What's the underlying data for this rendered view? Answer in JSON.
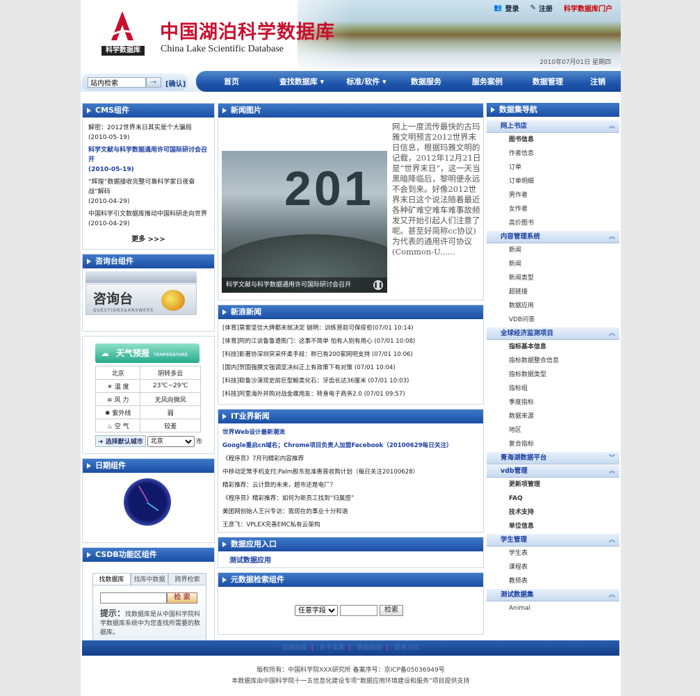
{
  "header": {
    "title_cn": "中国湖泊科学数据库",
    "title_en": "China Lake Scientific Database",
    "logo_label": "科学数据库",
    "login": "登录",
    "register": "注册",
    "portal": "科学数据库门户",
    "date": "2010年07月01日  星期四"
  },
  "search": {
    "placeholder": "站内检索",
    "confirm": "[确认]"
  },
  "nav": [
    "首页",
    "查找数据库 ▾",
    "标准/软件 ▾",
    "数据服务",
    "服务案例",
    "数据管理",
    "注销"
  ],
  "cms": {
    "title": "CMS组件",
    "items": [
      {
        "text": "解密：2012世界末日其实是个大骗局",
        "date": "(2010-05-19)",
        "hot": false
      },
      {
        "text": "科学文献与科学数据通用许可国际研讨会召开",
        "date": "(2010-05-19)",
        "hot": true
      },
      {
        "text": "“辉煌”数据接收完整可靠科学家日夜奋战”解码",
        "date": "(2010-04-29)",
        "hot": false
      },
      {
        "text": "中国科学引文数据库推动中国科研走向世界",
        "date": "(2010-04-29)",
        "hot": false
      }
    ],
    "more": "更多 >>>"
  },
  "consult": {
    "title": "咨询台组件",
    "big": "咨询台",
    "sub": "QUESTIONS&ANSWERS"
  },
  "weather": {
    "title": "天气预报",
    "tag": "TEMPERATURE",
    "city": "北京",
    "cond": "阴转多云",
    "rows": [
      {
        "k": "温   度",
        "v": "23℃~29℃"
      },
      {
        "k": "风   力",
        "v": "无风向微风"
      },
      {
        "k": "紫外线",
        "v": "弱"
      },
      {
        "k": "空   气",
        "v": "较差"
      }
    ],
    "select_btn": "选择默认城市",
    "select_val": "北京",
    "suffix": "市"
  },
  "clock": {
    "title": "日期组件"
  },
  "csdb": {
    "title": "CSDB功能区组件",
    "tabs": [
      "找数据库",
      "找库中数据",
      "跨界检索"
    ],
    "go": "检 索",
    "tip_head": "提示：",
    "tip": "找数据库是从中国科学院科学数据库系统中为您查找所需要的数据库。"
  },
  "newspic": {
    "title": "新闻图片",
    "caption": "科学文献与科学数据通用许可国际研讨会召开",
    "num": "201",
    "text": "网上一度流传最快的古玛雅文明预言2012世界末日信息，根据玛雅文明的记载，2012年12月21日是“世界末日”，这一天当黑暗降临后，黎明便永远不会到来。好像2012世界末日这个说法随着最近各种矿难空难车难事故频发又开始引起人们注意了呢。甚至好简称cc协议)为代表的通用许可协议(Common-U......"
  },
  "sina": {
    "title": "新浪新闻",
    "items": [
      "[体育]莫雷坚信大牌都未就决定  姚明：训练营前可保痊愈(07/01 10:14)",
      "[体育]阿的江谈鲁鲁遗衙门：这事不简单 怕有人别有用心 (07/01 10:08)",
      "[科技]影著协深圳突采怀柔手段：称已有200家网吧支持 (07/01 10:06)",
      "[国内]贺国强撰文强调坚决纠正上有政策下有对策 (07/01 10:04)",
      "[科技]聪鲁沙漠现史前巨型鲸类化石：牙齿长达36厘米 (07/01 10:03)",
      "[科技]阿里海外并购对战金蝶用友：转身电子商务2.0 (07/01 09:57)"
    ]
  },
  "it": {
    "title": "IT业界新闻",
    "items": [
      {
        "t": "世界Web设计最新潮流",
        "hot": true
      },
      {
        "t": "Google重启cn域名；Chrome项目负责人加盟Facebook（20100629每日关注）",
        "hot": true
      },
      {
        "t": "《程序员》7月刊精彩内容推荐",
        "hot": false
      },
      {
        "t": "中移动定常手机支付;Palm股东批准惠普收购计划（每日关注20100628）",
        "hot": false
      },
      {
        "t": "精彩推荐：云计算的未来，超市还是电厂？",
        "hot": false
      },
      {
        "t": "《程序员》精彩推荐：如何为新员工找到“归属感”",
        "hot": false
      },
      {
        "t": "美团网创始人王兴专访：我现在的事业十分和谐",
        "hot": false
      },
      {
        "t": "王彦飞：VPLEX完善EMC私有云架构",
        "hot": false
      }
    ]
  },
  "dataapp": {
    "title": "数据应用入口",
    "item": "测试数据应用"
  },
  "meta": {
    "title": "元数据检索组件",
    "field": "任意字段",
    "btn": "检索"
  },
  "rnav": {
    "title": "数据集导航",
    "groups": [
      {
        "name": "网上书店",
        "chev": "︽",
        "items": [
          {
            "t": "图书信息",
            "b": true
          },
          {
            "t": "作者信息"
          },
          {
            "t": "订单"
          },
          {
            "t": "订单明细"
          },
          {
            "t": "男作者"
          },
          {
            "t": "女作者"
          },
          {
            "t": "高价图书"
          }
        ]
      },
      {
        "name": "内容管理系统",
        "chev": "︽",
        "items": [
          {
            "t": "新闻"
          },
          {
            "t": "新闻"
          },
          {
            "t": "新闻类型"
          },
          {
            "t": "超链接"
          },
          {
            "t": "数据应用"
          },
          {
            "t": "VDB问答"
          }
        ]
      },
      {
        "name": "全球经济监测项目",
        "chev": "︽",
        "items": [
          {
            "t": "指标基本信息",
            "b": true
          },
          {
            "t": "指标数据整合信息"
          },
          {
            "t": "指标数据类型"
          },
          {
            "t": "指标组"
          },
          {
            "t": "季度指标"
          },
          {
            "t": "数据来源"
          },
          {
            "t": "地区"
          },
          {
            "t": "复合指标"
          }
        ]
      },
      {
        "name": "青海湖数据平台",
        "chev": "︾",
        "items": []
      },
      {
        "name": "vdb管理",
        "chev": "︽",
        "items": [
          {
            "t": "更新项管理",
            "b": true
          },
          {
            "t": "FAQ",
            "b": true
          },
          {
            "t": "技术支持",
            "b": true
          },
          {
            "t": "单位信息",
            "b": true
          }
        ]
      },
      {
        "name": "学生管理",
        "chev": "︽",
        "items": [
          {
            "t": "学生表"
          },
          {
            "t": "课程表"
          },
          {
            "t": "教师表"
          }
        ]
      },
      {
        "name": "测试数据集",
        "chev": "︽",
        "items": [
          {
            "t": "Animal"
          }
        ]
      }
    ]
  },
  "footer": {
    "links": [
      "咨询指南",
      "关于本库",
      "数据使用",
      "联系方式"
    ],
    "line1": "版权所有：中国科学院XXX研究所  备案序号：京ICP备05036949号",
    "line2": "本数据库由中国科学院十一五信息化建设专项“数据应用环境建设和服务”项目提供支持"
  }
}
